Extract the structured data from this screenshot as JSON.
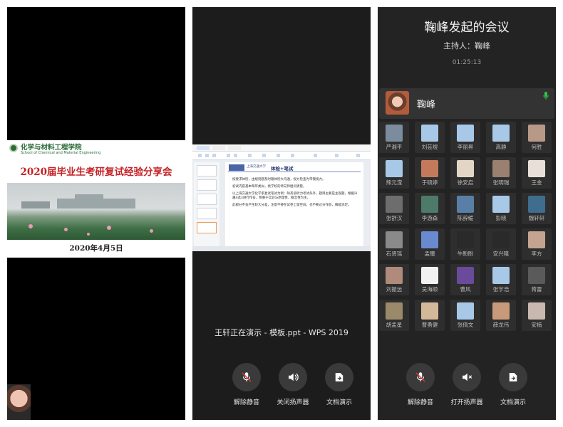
{
  "left_panel": {
    "slide": {
      "school_cn": "化学与材料工程学院",
      "school_en": "School of Chemical and Material Engineering",
      "title": "2020届毕业生考研复试经验分享会",
      "date": "2020年4月5日"
    }
  },
  "middle_panel": {
    "slide": {
      "logo_text": "上海交通大学",
      "title": "体检+笔试",
      "bullets": [
        "按要求体检，由规则题及时跟体检大沟通，视力检查为带镜视力。",
        "初试内容基本每年类似，找学校的师兄师姐问清楚。",
        "以上海交通大学化学系复试笔试为例：除英语听力考试条外，题目主要是主观题，根据兴趣4选3进行作答，侧重于实验与原理性、概念性为主。",
        "此部分不会产生较大分差，注意不要在试卷上留空白，也不要过分作答，确能添足。"
      ]
    },
    "presenting_text": "王轩正在演示 - 模板.ppt - WPS 2019",
    "controls": [
      {
        "label": "解除静音",
        "icon": "mic-muted-icon"
      },
      {
        "label": "关闭扬声器",
        "icon": "speaker-icon"
      },
      {
        "label": "文档演示",
        "icon": "share-doc-icon"
      }
    ]
  },
  "right_panel": {
    "meeting_title": "鞠峰发起的会议",
    "host_line": "主持人：鞠峰",
    "timer": "01:25:13",
    "host": {
      "name": "鞠峰",
      "mic": "mic-active-icon"
    },
    "participants": [
      {
        "name": "严湘平",
        "color": "#7a8c9e"
      },
      {
        "name": "刘芸煜",
        "color": "#a8c8e8"
      },
      {
        "name": "李丽昇",
        "color": "#a8c8e8"
      },
      {
        "name": "高静",
        "color": "#a8c8e8"
      },
      {
        "name": "何胜",
        "color": "#b89886"
      },
      {
        "name": "熊元滢",
        "color": "#a8c8e8"
      },
      {
        "name": "于硕婷",
        "color": "#c47a5a"
      },
      {
        "name": "徐安启",
        "color": "#e4d6c6"
      },
      {
        "name": "张明瑞",
        "color": "#9a8070"
      },
      {
        "name": "王金",
        "color": "#e8e0d8"
      },
      {
        "name": "张舒汉",
        "color": "#6d6d6d"
      },
      {
        "name": "李游森",
        "color": "#4e7a6a"
      },
      {
        "name": "陈辞缓",
        "color": "#5a7fa6"
      },
      {
        "name": "彭晓",
        "color": "#a8c8e8"
      },
      {
        "name": "魏轩轩",
        "color": "#3f6d8e"
      },
      {
        "name": "石贤瑶",
        "color": "#8a8a8a"
      },
      {
        "name": "孟瞳",
        "color": "#6a8ad0"
      },
      {
        "name": "牛盼盼",
        "color": "#2a2a2a"
      },
      {
        "name": "安兴隆",
        "color": "#2a2a2a"
      },
      {
        "name": "李方",
        "color": "#c4a490"
      },
      {
        "name": "刘振远",
        "color": "#b08a7a"
      },
      {
        "name": "吴海顺",
        "color": "#f2f2f2"
      },
      {
        "name": "曹风",
        "color": "#6a4a9a"
      },
      {
        "name": "张宇浩",
        "color": "#a8c8e8"
      },
      {
        "name": "蒋雷",
        "color": "#5a5a5a"
      },
      {
        "name": "胡孟星",
        "color": "#9a8a6a"
      },
      {
        "name": "曹勇健",
        "color": "#d4b89a"
      },
      {
        "name": "张倩文",
        "color": "#a8c8e8"
      },
      {
        "name": "薛龙伟",
        "color": "#c89a7a"
      },
      {
        "name": "安楠",
        "color": "#c8b8b0"
      }
    ],
    "controls": [
      {
        "label": "解除静音",
        "icon": "mic-muted-icon"
      },
      {
        "label": "打开扬声器",
        "icon": "speaker-muted-icon"
      },
      {
        "label": "文档演示",
        "icon": "share-doc-icon"
      }
    ]
  }
}
